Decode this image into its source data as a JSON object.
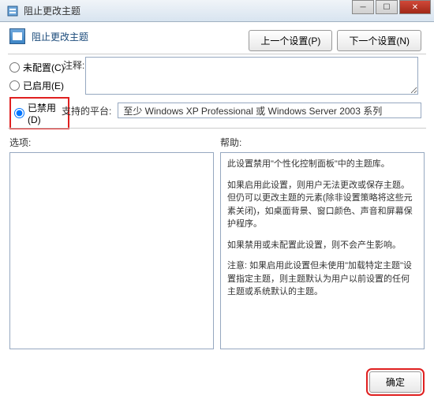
{
  "titlebar": {
    "title": "阻止更改主题"
  },
  "header": {
    "title": "阻止更改主题"
  },
  "nav": {
    "prev": "上一个设置(P)",
    "next": "下一个设置(N)"
  },
  "radios": {
    "not_configured": "未配置(C)",
    "enabled": "已启用(E)",
    "disabled": "已禁用(D)"
  },
  "labels": {
    "comment": "注释:",
    "platform": "支持的平台:",
    "options": "选项:",
    "help": "帮助:"
  },
  "platform": {
    "text": "至少 Windows XP Professional 或 Windows Server 2003 系列"
  },
  "help": {
    "p1": "此设置禁用\"个性化控制面板\"中的主题库。",
    "p2": "如果启用此设置，则用户无法更改或保存主题。但仍可以更改主题的元素(除非设置策略将这些元素关闭)，如桌面背景、窗口颜色、声音和屏幕保护程序。",
    "p3": "如果禁用或未配置此设置，则不会产生影响。",
    "p4": "注意: 如果启用此设置但未使用\"加载特定主题\"设置指定主题，则主题默认为用户以前设置的任何主题或系统默认的主题。"
  },
  "footer": {
    "ok": "确定"
  }
}
